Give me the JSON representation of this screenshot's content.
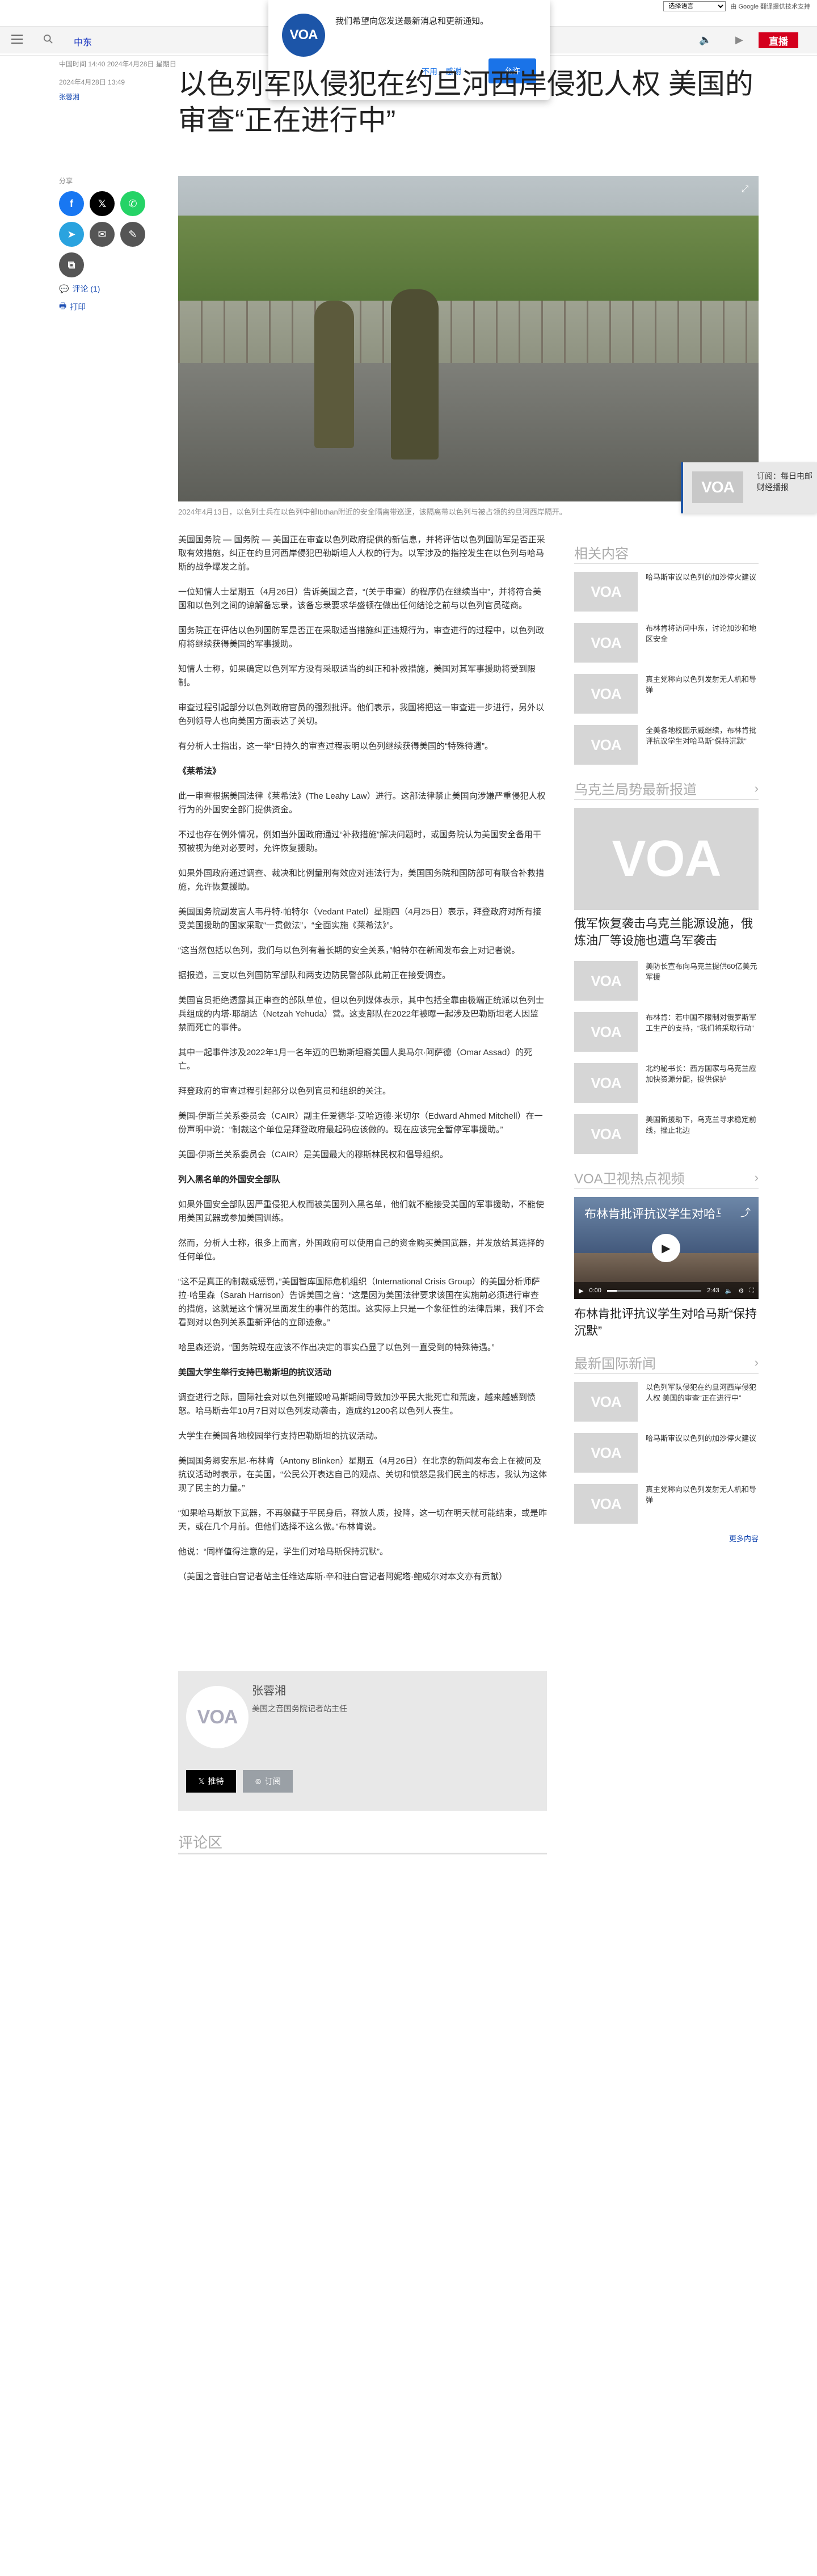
{
  "topbar": {
    "language_select": "选择语言",
    "powered_by": "由 Google 翻译提供技术支持"
  },
  "header": {
    "section_label": "中东",
    "live_button": "直播"
  },
  "notification": {
    "message": "我们希望向您发送最新消息和更新通知。",
    "decline": "不用，感谢",
    "accept": "允许",
    "logo_text": "VOA"
  },
  "article": {
    "updated_time": "中国时间 14:40 2024年4月28日 星期日",
    "published_time": "2024年4月28日 13:49",
    "author": "张蓉湘",
    "title": "以色列军队侵犯在约旦河西岸侵犯人权 美国的审查“正在进行中”",
    "caption": "2024年4月13日，以色列士兵在以色列中部Ibthan附近的安全隔离带巡逻，该隔离带以色列与被占领的约旦河西岸隔开。",
    "paragraphs": [
      {
        "type": "p",
        "text": "美国国务院 — 国务院 — 美国正在审查以色列政府提供的新信息，并将评估以色列国防军是否正采取有效措施，纠正在约旦河西岸侵犯巴勒斯坦人人权的行为。以军涉及的指控发生在以色列与哈马斯的战争爆发之前。"
      },
      {
        "type": "p",
        "text": "一位知情人士星期五（4月26日）告诉美国之音，“(关于审查）的程序仍在继续当中”，并将符合美国和以色列之间的谅解备忘录，该备忘录要求华盛顿在做出任何结论之前与以色列官员磋商。"
      },
      {
        "type": "p",
        "text": "国务院正在评估以色列国防军是否正在采取适当措施纠正违规行为，审查进行的过程中，以色列政府将继续获得美国的军事援助。"
      },
      {
        "type": "p",
        "text": "知情人士称，如果确定以色列军方没有采取适当的纠正和补救措施，美国对其军事援助将受到限制。"
      },
      {
        "type": "p",
        "text": "审查过程引起部分以色列政府官员的强烈批评。他们表示，我国将把这一审查进一步进行，另外以色列领导人也向美国方面表达了关切。"
      },
      {
        "type": "p",
        "text": "有分析人士指出，这一举“日持久的审查过程表明以色列继续获得美国的“特殊待遇”。"
      },
      {
        "type": "h",
        "text": "《莱希法》"
      },
      {
        "type": "p",
        "text": "此一审查根据美国法律《莱希法》(The Leahy Law）进行。这部法律禁止美国向涉嫌严重侵犯人权行为的外国安全部门提供资金。"
      },
      {
        "type": "p",
        "text": "不过也存在例外情况，例如当外国政府通过“补救措施”解决问题时，或国务院认为美国安全备用干预被视为绝对必要时，允许恢复援助。"
      },
      {
        "type": "p",
        "text": "如果外国政府通过调查、裁决和比例量刑有效应对违法行为，美国国务院和国防部可有联合补救措施，允许恢复援助。"
      },
      {
        "type": "p",
        "text": "美国国务院副发言人韦丹特·帕特尔（Vedant Patel）星期四（4月25日）表示，拜登政府对所有接受美国援助的国家采取“一贯做法”，“全面实施《莱希法》”。"
      },
      {
        "type": "p",
        "text": "“这当然包括以色列，我们与以色列有着长期的安全关系，”帕特尔在新闻发布会上对记者说。"
      },
      {
        "type": "p",
        "text": "据报道，三支以色列国防军部队和两支边防民警部队此前正在接受调查。"
      },
      {
        "type": "p",
        "text": "美国官员拒绝透露其正审查的部队单位，但以色列媒体表示，其中包括全靠由极端正统派以色列士兵组成的内塔·耶胡达（Netzah Yehuda）营。这支部队在2022年被曝一起涉及巴勒斯坦老人因监禁而死亡的事件。"
      },
      {
        "type": "p",
        "text": "其中一起事件涉及2022年1月一名年迈的巴勒斯坦裔美国人奥马尔·阿萨德（Omar Assad）的死亡。"
      },
      {
        "type": "p",
        "text": "拜登政府的审查过程引起部分以色列官员和组织的关注。"
      },
      {
        "type": "p",
        "text": "美国-伊斯兰关系委员会（CAIR）副主任爱德华·艾哈迈德·米切尔（Edward Ahmed Mitchell）在一份声明中说：“制裁这个单位是拜登政府最起码应该做的。现在应该完全暂停军事援助。”"
      },
      {
        "type": "p",
        "text": "美国-伊斯兰关系委员会（CAIR）是美国最大的穆斯林民权和倡导组织。"
      },
      {
        "type": "h",
        "text": "列入黑名单的外国安全部队"
      },
      {
        "type": "p",
        "text": "如果外国安全部队因严重侵犯人权而被美国列入黑名单，他们就不能接受美国的军事援助，不能使用美国武器或参加美国训练。"
      },
      {
        "type": "p",
        "text": "然而，分析人士称，很多上而言，外国政府可以使用自己的资金购买美国武器，并发放给其选择的任何单位。"
      },
      {
        "type": "p",
        "text": "“这不是真正的制裁或惩罚，”美国智库国际危机组织（International Crisis Group）的美国分析师萨拉·哈里森（Sarah Harrison）告诉美国之音：“这是因为美国法律要求该国在实施前必须进行审查的措施，这就是这个情况里面发生的事件的范围。这实际上只是一个象征性的法律后果，我们不会看到对以色列关系重新评估的立即迹象。”"
      },
      {
        "type": "p",
        "text": "哈里森还说，“国务院现在应该不作出决定的事实凸显了以色列一直受到的特殊待遇。”"
      },
      {
        "type": "h",
        "text": "美国大学生举行支持巴勒斯坦的抗议活动"
      },
      {
        "type": "p",
        "text": "调查进行之际，国际社会对以色列摧毁哈马斯期间导致加沙平民大批死亡和荒废，越来越感到愤怒。哈马斯去年10月7日对以色列发动袭击，造成约1200名以色列人丧生。"
      },
      {
        "type": "p",
        "text": "大学生在美国各地校园举行支持巴勒斯坦的抗议活动。"
      },
      {
        "type": "p",
        "text": "美国国务卿安东尼·布林肯（Antony Blinken）星期五（4月26日）在北京的新闻发布会上在被问及抗议活动时表示，在美国，“公民公开表达自己的观点、关切和愤怒是我们民主的标志，我认为这体现了民主的力量。”"
      },
      {
        "type": "p",
        "text": "“如果哈马斯放下武器，不再躲藏于平民身后，释放人质，投降，这一切在明天就可能结束，或是昨天，或在几个月前。但他们选择不这么做。”布林肯说。"
      },
      {
        "type": "p",
        "text": "他说：“同样值得注意的是，学生们对哈马斯保持沉默”。"
      },
      {
        "type": "p",
        "text": "（美国之音驻白宫记者站主任维达库斯·辛和驻白宫记者阿妮塔·鲍威尔对本文亦有贡献）"
      }
    ]
  },
  "share": {
    "label": "分享",
    "buttons": [
      {
        "name": "facebook",
        "glyph": "f",
        "color": "#1877f2"
      },
      {
        "name": "x",
        "glyph": "𝕏",
        "color": "#000000"
      },
      {
        "name": "whatsapp",
        "glyph": "✆",
        "color": "#25d366"
      },
      {
        "name": "telegram",
        "glyph": "➤",
        "color": "#2aa3df"
      },
      {
        "name": "email",
        "glyph": "✉",
        "color": "#555555"
      },
      {
        "name": "sms",
        "glyph": "✎",
        "color": "#555555"
      },
      {
        "name": "copy-link",
        "glyph": "⧉",
        "color": "#555555"
      }
    ],
    "comments_link": "评论 (1)",
    "print_link": "打印"
  },
  "float_widget": {
    "text": "订阅：每日电邮财经播报"
  },
  "author_box": {
    "name": "张蓉湘",
    "title": "美国之音国务院记者站主任",
    "follow": "推特",
    "subscribe": "订阅"
  },
  "comments": {
    "heading": "评论区"
  },
  "sidebar": {
    "related": {
      "heading": "相关内容",
      "items": [
        "哈马斯审议以色列的加沙停火建议",
        "布林肯将访问中东，讨论加沙和地区安全",
        "真主党称向以色列发射无人机和导弹",
        "全美各地校园示威继续，布林肯批评抗议学生对哈马斯“保持沉默”"
      ]
    },
    "ukraine": {
      "heading": "乌克兰局势最新报道",
      "feature": "俄军恢复袭击乌克兰能源设施，俄炼油厂等设施也遭乌军袭击",
      "items": [
        "美防长宣布向乌克兰提供60亿美元军援",
        "布林肯：若中国不限制对俄罗斯军工生产的支持，“我们将采取行动”",
        "北约秘书长：西方国家与乌克兰应加快资源分配，提供保护",
        "美国新援助下，乌克兰寻求稳定前线，挫止北边"
      ]
    },
    "video": {
      "heading": "VOA卫视热点视频",
      "card_title": "布林肯批评抗议学生对哈马...",
      "time_current": "0:00",
      "time_total": "2:43",
      "progress": 0.1,
      "caption": "布林肯批评抗议学生对哈马斯“保持沉默”"
    },
    "intl": {
      "heading": "最新国际新闻",
      "items": [
        "以色列军队侵犯在约旦河西岸侵犯人权 美国的审查“正在进行中”",
        "哈马斯审议以色列的加沙停火建议",
        "真主党称向以色列发射无人机和导弹"
      ],
      "more": "更多内容"
    }
  }
}
